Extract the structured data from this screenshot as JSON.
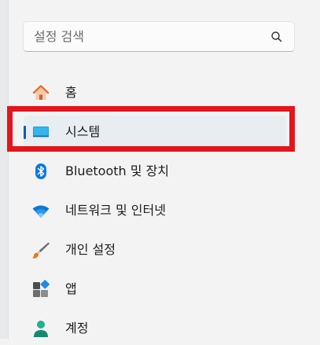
{
  "search": {
    "placeholder": "설정 검색"
  },
  "nav": {
    "items": [
      {
        "label": "홈",
        "icon": "home-icon"
      },
      {
        "label": "시스템",
        "icon": "system-monitor-icon",
        "selected": true
      },
      {
        "label": "Bluetooth 및 장치",
        "icon": "bluetooth-icon"
      },
      {
        "label": "네트워크 및 인터넷",
        "icon": "wifi-icon"
      },
      {
        "label": "개인 설정",
        "icon": "paintbrush-icon"
      },
      {
        "label": "앱",
        "icon": "apps-icon"
      },
      {
        "label": "계정",
        "icon": "account-icon"
      }
    ]
  },
  "colors": {
    "accent": "#005fb8",
    "highlight": "#e3151d",
    "selected_bg": "#e8edf1"
  }
}
